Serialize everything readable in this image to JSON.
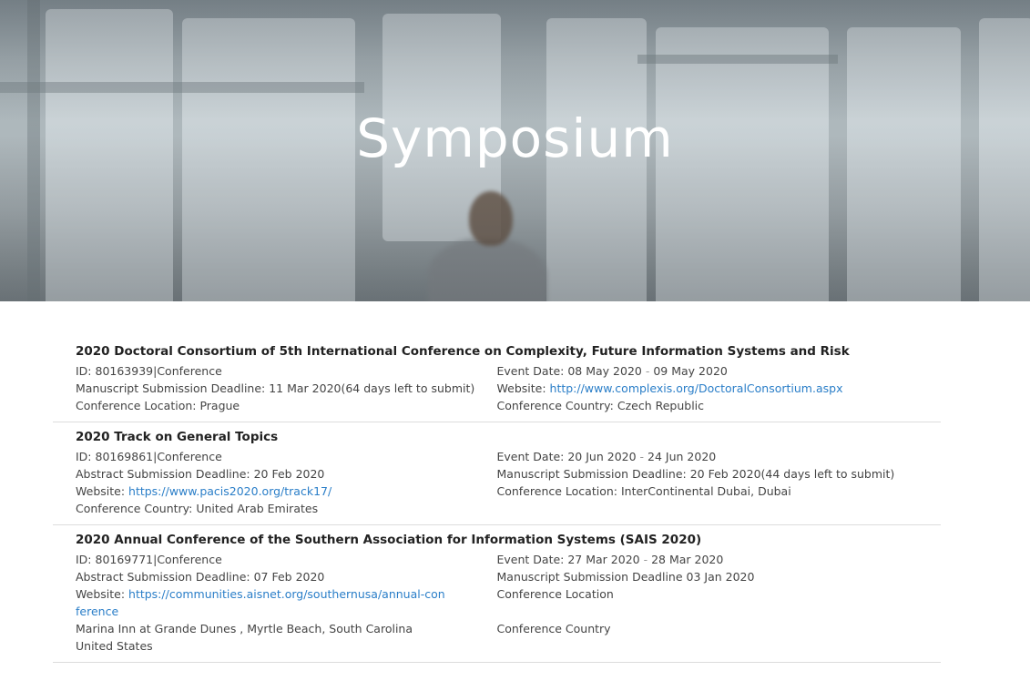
{
  "hero": {
    "title": "Symposium"
  },
  "conferences": [
    {
      "title": "2020 Doctoral Consortium of 5th International Conference on Complexity, Future Information Systems and Risk",
      "id": "ID: 80163939|Conference",
      "deadline": "Manuscript Submission Deadline: 11 Mar 2020(64 days left to submit)",
      "location": "Conference Location: Prague",
      "event_label": "Event Date:  ",
      "event_start": "08 May 2020",
      "event_end": "09 May 2020",
      "website_label": "Website:  ",
      "website": "http://www.complexis.org/DoctoralConsortium.aspx",
      "country": "Conference Country: Czech Republic"
    },
    {
      "title": "2020 Track on General Topics",
      "id": "ID: 80169861|Conference",
      "abstract_deadline": "Abstract Submission Deadline: 20 Feb 2020",
      "website_label": "Website:  ",
      "website": "https://www.pacis2020.org/track17/",
      "country": "Conference Country: United Arab Emirates",
      "event_label": "Event Date: ",
      "event_start": "20 Jun 2020",
      "event_end": "24 Jun 2020",
      "manuscript_deadline": "Manuscript Submission Deadline:  20 Feb 2020(44 days left to submit)",
      "location": "Conference Location: InterContinental Dubai, Dubai"
    },
    {
      "title": "2020 Annual Conference of the Southern Association for Information Systems (SAIS 2020)",
      "id": "ID: 80169771|Conference",
      "abstract_deadline": "Abstract Submission Deadline: 07 Feb 2020",
      "website_label": "Website:  ",
      "website": "https://communities.aisnet.org/southernusa/annual-conference",
      "address_line1": "Marina Inn at Grande Dunes , Myrtle Beach, South Carolina",
      "address_line2": "United States",
      "event_label": "Event Date:  ",
      "event_start": "27 Mar 2020",
      "event_end": "28 Mar 2020",
      "manuscript_deadline": "Manuscript Submission Deadline 03 Jan 2020",
      "location_label": "Conference Location",
      "country_label": "Conference Country"
    }
  ],
  "date_separator": " - "
}
